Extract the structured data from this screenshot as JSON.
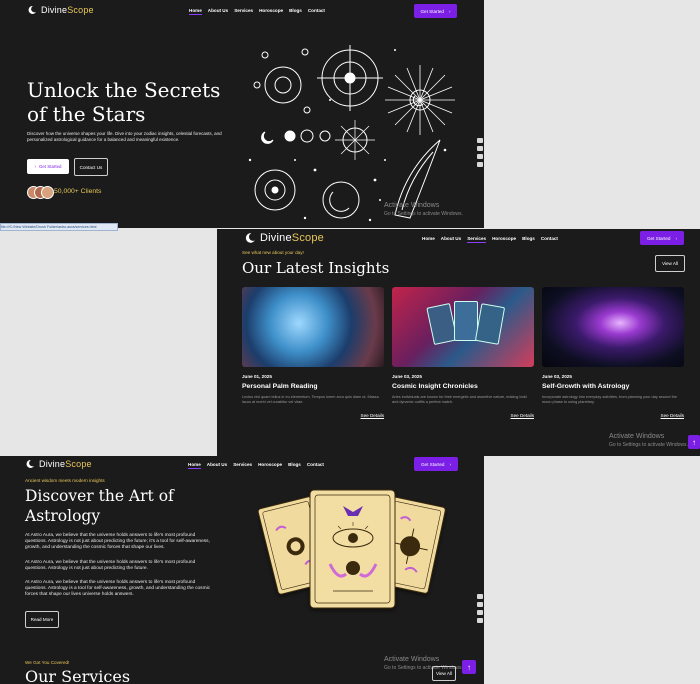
{
  "brand": {
    "name_a": "Divine",
    "name_b": "Scope"
  },
  "nav": {
    "home": "Home",
    "about": "About Us",
    "services": "Services",
    "horoscope": "Horoscope",
    "blogs": "Blogs",
    "contact": "Contact"
  },
  "get_started": "Get Started",
  "hero": {
    "title": "Unlock the Secrets of the Stars",
    "description": "Discover how the universe shapes your life. Dive into your zodiac insights, celestial forecasts, and personalized astrological guidance for a balanced and meaningful existence.",
    "btn_get_started": "Get Started",
    "btn_contact": "Contact Us",
    "clients": "50,000+ Clients"
  },
  "status_url": "file:///C:/New Website/Drush Folder/astro-aura/services.html",
  "activate": {
    "title": "Activate Windows",
    "sub": "Go to Settings to activate Windows."
  },
  "insights": {
    "kicker": "See what new about your day!",
    "heading": "Our Latest Insights",
    "view_all": "View All",
    "cards": [
      {
        "date": "June 01, 2025",
        "title": "Personal Palm Reading",
        "desc": "Lectus nisi quam tellus in eu elementum. Tempus lorem arcu quis diam ut. Massa lacus at morbi vel curabitur vel vitae.",
        "link": "See Details"
      },
      {
        "date": "June 03, 2025",
        "title": "Cosmic Insight Chronicles",
        "desc": "Aries individuals are known for their energetic and assertive nature, making bold and dynamic outfits a perfect match.",
        "link": "See Details"
      },
      {
        "date": "June 03, 2025",
        "title": "Self-Growth with Astrology",
        "desc": "Incorporate astrology into everyday activities, from planning your day around the moon phase to using planetary.",
        "link": "See Details"
      }
    ]
  },
  "art": {
    "kicker": "Ancient wisdom meets modern insights",
    "heading": "Discover the Art of Astrology",
    "p1": "At Astro Aura, we believe that the universe holds answers to life's most profound questions. Astrology is not just about predicting the future; it's a tool for self-awareness, growth, and understanding the cosmic forces that shape our lives.",
    "p2": "At Astro Aura, we believe that the universe holds answers to life's most profound questions. Astrology is not just about predicting the future.",
    "p3": "At Astro Aura, we believe that the universe holds answers to life's most profound questions. Astrology is a tool for self-awareness, growth, and understanding the cosmic forces that shape our lives universe holds answers.",
    "read_more": "Read More",
    "services_kicker": "We Got You Covered!",
    "services_heading": "Our Services",
    "view_all": "View All"
  },
  "colors": {
    "accent": "#7b1fe6",
    "gold": "#e8c75a",
    "panel": "#1b1b1b"
  }
}
